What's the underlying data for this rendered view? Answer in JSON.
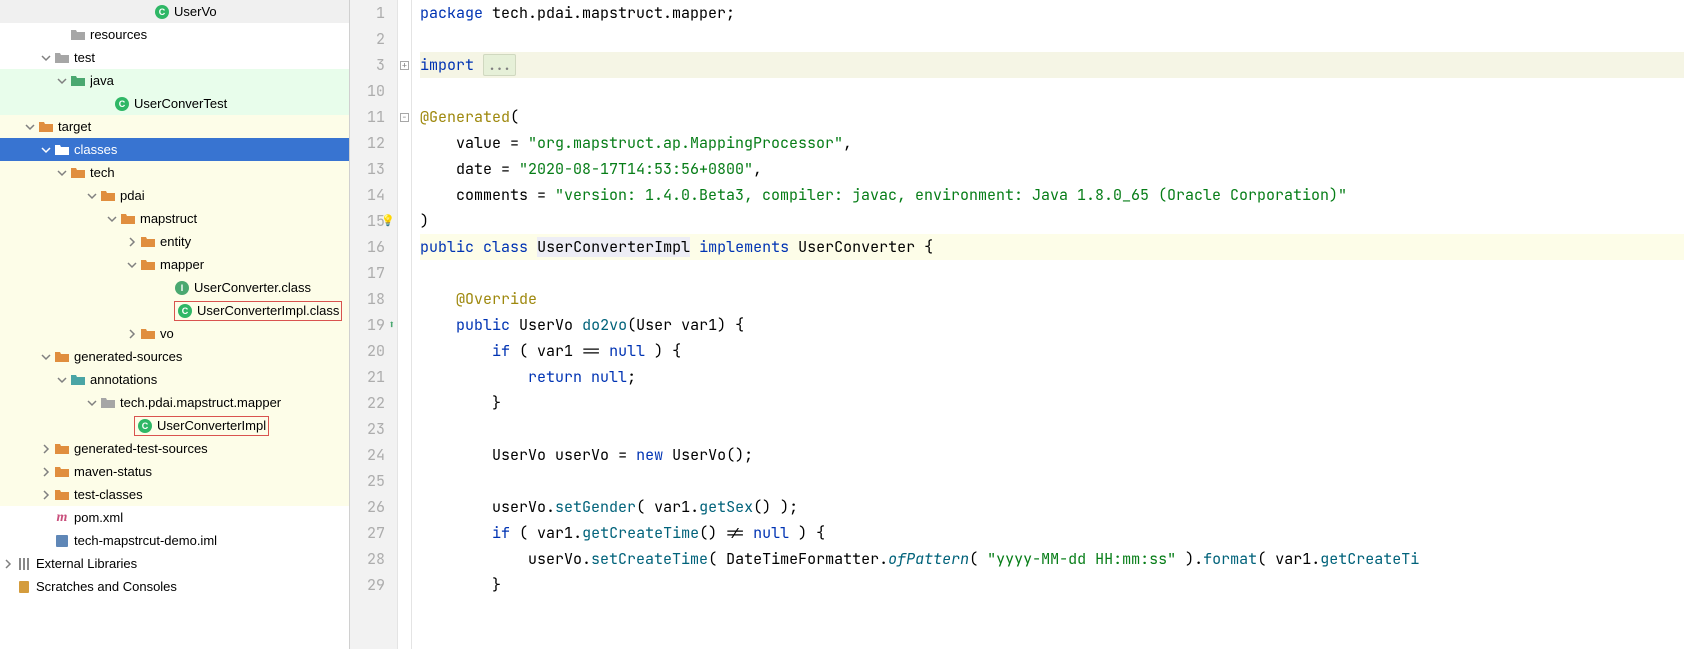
{
  "tree": {
    "userVo": "UserVo",
    "resources": "resources",
    "test": "test",
    "java": "java",
    "userConverTest": "UserConverTest",
    "target": "target",
    "classes": "classes",
    "tech": "tech",
    "pdai": "pdai",
    "mapstruct": "mapstruct",
    "entity": "entity",
    "mapper": "mapper",
    "userConverterClass": "UserConverter.class",
    "userConverterImplClass": "UserConverterImpl.class",
    "vo": "vo",
    "generatedSources": "generated-sources",
    "annotations": "annotations",
    "techPkg": "tech.pdai.mapstruct.mapper",
    "userConverterImpl": "UserConverterImpl",
    "generatedTestSources": "generated-test-sources",
    "mavenStatus": "maven-status",
    "testClasses": "test-classes",
    "pomXml": "pom.xml",
    "iml": "tech-mapstrcut-demo.iml",
    "externalLibraries": "External Libraries",
    "scratches": "Scratches and Consoles"
  },
  "lines": [
    "1",
    "2",
    "3",
    "10",
    "11",
    "12",
    "13",
    "14",
    "15",
    "16",
    "17",
    "18",
    "19",
    "20",
    "21",
    "22",
    "23",
    "24",
    "25",
    "26",
    "27",
    "28",
    "29"
  ],
  "code": {
    "pkg_kw": "package",
    "pkg_name": " tech.pdai.mapstruct.mapper;",
    "import_kw": "import",
    "import_fold": "...",
    "gen_anno": "@Generated",
    "gen_open": "(",
    "value_label": "    value = ",
    "value_str": "\"org.mapstruct.ap.MappingProcessor\"",
    "comma": ",",
    "date_label": "    date = ",
    "date_str": "\"2020-08-17T14:53:56+0800\"",
    "comments_label": "    comments = ",
    "comments_str": "\"version: 1.4.0.Beta3, compiler: javac, environment: Java 1.8.0_65 (Oracle Corporation)\"",
    "gen_close": ")",
    "public_kw": "public",
    "class_kw": "class",
    "class_name": "UserConverterImpl",
    "implements_kw": "implements",
    "iface_name": "UserConverter",
    "brace_open": " {",
    "override": "@Override",
    "uservo_type": "UserVo",
    "do2vo": "do2vo",
    "user_type": "User",
    "var1": "var1",
    "mparen_close": ") {",
    "if_kw": "if",
    "null_kw": "null",
    "eq": " == ",
    "return_kw": "return",
    "semi": ";",
    "brace_close": "}",
    "uservo_var": "userVo",
    "eq_assign": " = ",
    "new_kw": "new",
    "ctor": "UserVo",
    "ctor_paren": "();",
    "setGender": "setGender",
    "getSex": "getSex",
    "getCreateTime": "getCreateTime",
    "neq": " != ",
    "setCreateTime": "setCreateTime",
    "dtf": "DateTimeFormatter",
    "ofPattern": "ofPattern",
    "pattern_str": "\"yyyy-MM-dd HH:mm:ss\"",
    "format": "format",
    "getCreateTi": "getCreateTi"
  }
}
